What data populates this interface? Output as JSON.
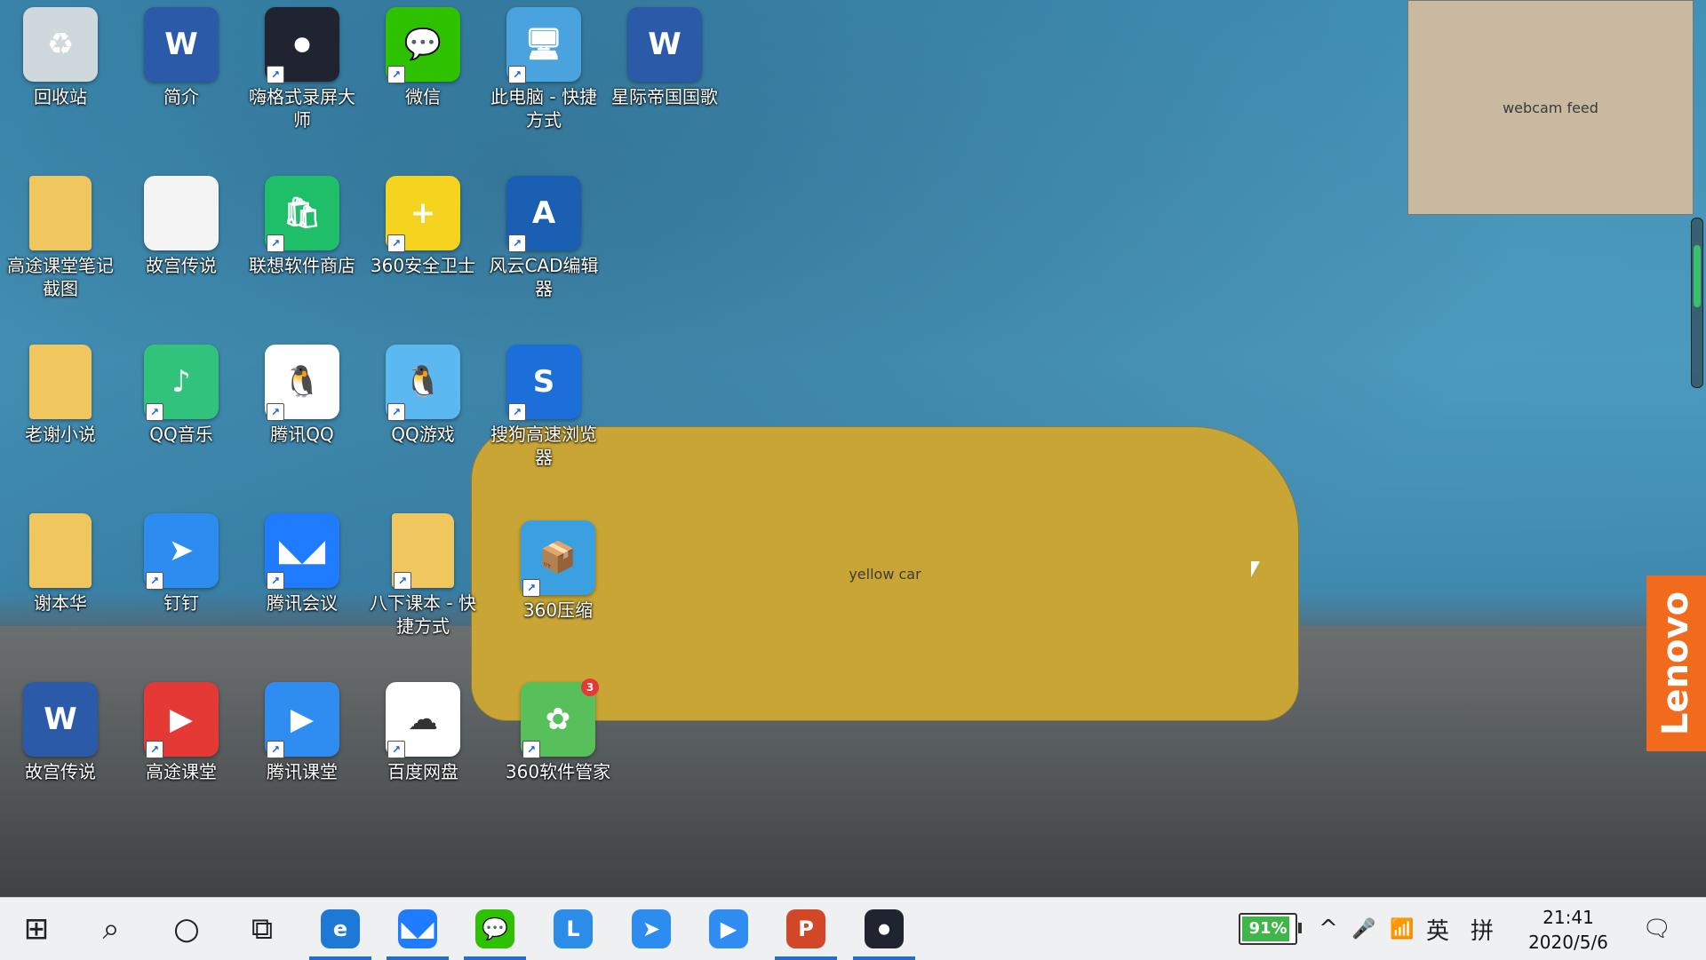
{
  "desktop_icons": [
    {
      "label": "回收站",
      "icon": "recycle-bin-icon",
      "glyph": "♻",
      "color": "#cfd8dc",
      "shortcut": false
    },
    {
      "label": "简介",
      "icon": "word-doc-icon",
      "glyph": "W",
      "color": "#2b5aa8",
      "shortcut": false
    },
    {
      "label": "嗨格式录屏大\n师",
      "icon": "screen-recorder-icon",
      "glyph": "⏺",
      "color": "#1f2430",
      "shortcut": true
    },
    {
      "label": "微信",
      "icon": "wechat-icon",
      "glyph": "💬",
      "color": "#2dc100",
      "shortcut": true
    },
    {
      "label": "此电脑 - 快捷\n方式",
      "icon": "this-pc-icon",
      "glyph": "🖥",
      "color": "#4aa3df",
      "shortcut": true
    },
    {
      "label": "星际帝国国歌",
      "icon": "word-doc-icon",
      "glyph": "W",
      "color": "#2b5aa8",
      "shortcut": false
    },
    {
      "label": "高途课堂笔记\n截图",
      "icon": "folder-icon",
      "glyph": "",
      "color": "#f0c75e",
      "shortcut": false
    },
    {
      "label": "故宫传说",
      "icon": "text-file-icon",
      "glyph": "",
      "color": "#f4f4f4",
      "shortcut": false
    },
    {
      "label": "联想软件商店",
      "icon": "lenovo-store-icon",
      "glyph": "🛍",
      "color": "#1fbf6a",
      "shortcut": true
    },
    {
      "label": "360安全卫士",
      "icon": "360-security-icon",
      "glyph": "+",
      "color": "#f4d41e",
      "shortcut": true
    },
    {
      "label": "风云CAD编辑\n器",
      "icon": "cad-editor-icon",
      "glyph": "A",
      "color": "#1b5fb3",
      "shortcut": true
    },
    {
      "label": "老谢小说",
      "icon": "folder-icon",
      "glyph": "",
      "color": "#f0c75e",
      "shortcut": false
    },
    {
      "label": "QQ音乐",
      "icon": "qq-music-icon",
      "glyph": "♪",
      "color": "#31c27c",
      "shortcut": true
    },
    {
      "label": "腾讯QQ",
      "icon": "qq-penguin-icon",
      "glyph": "🐧",
      "color": "#ffffff",
      "shortcut": true
    },
    {
      "label": "QQ游戏",
      "icon": "qq-game-icon",
      "glyph": "🐧",
      "color": "#5bb8f0",
      "shortcut": true
    },
    {
      "label": "搜狗高速浏览\n器",
      "icon": "sogou-browser-icon",
      "glyph": "S",
      "color": "#1c6fd8",
      "shortcut": true
    },
    {
      "label": "谢本华",
      "icon": "folder-icon",
      "glyph": "",
      "color": "#f0c75e",
      "shortcut": false
    },
    {
      "label": "钉钉",
      "icon": "dingtalk-icon",
      "glyph": "➤",
      "color": "#2d8cf0",
      "shortcut": true
    },
    {
      "label": "腾讯会议",
      "icon": "tencent-meeting-icon",
      "glyph": "◣◢",
      "color": "#1f7bff",
      "shortcut": true
    },
    {
      "label": "八下课本 - 快\n捷方式",
      "icon": "folder-icon",
      "glyph": "",
      "color": "#f0c75e",
      "shortcut": true
    },
    {
      "label": "360压缩",
      "icon": "360-zip-icon",
      "glyph": "📦",
      "color": "#3aa0e0",
      "shortcut": true
    },
    {
      "label": "故宫传说",
      "icon": "word-doc-icon",
      "glyph": "W",
      "color": "#2b5aa8",
      "shortcut": false
    },
    {
      "label": "高途课堂",
      "icon": "gaotu-classroom-icon",
      "glyph": "▶",
      "color": "#e53935",
      "shortcut": true
    },
    {
      "label": "腾讯课堂",
      "icon": "tencent-classroom-icon",
      "glyph": "▶",
      "color": "#2f8cf0",
      "shortcut": true
    },
    {
      "label": "百度网盘",
      "icon": "baidu-netdisk-icon",
      "glyph": "☁",
      "color": "#ffffff",
      "shortcut": true
    },
    {
      "label": "360软件管家",
      "icon": "360-software-manager-icon",
      "glyph": "✿",
      "color": "#58c05a",
      "shortcut": true,
      "badge": "3"
    }
  ],
  "webcam_overlay": {
    "icon": "webcam-feed"
  },
  "lenovo_tab": {
    "label": "Lenovo",
    "color": "#f26a1b"
  },
  "taskbar": {
    "start_icon": "windows-start-icon",
    "buttons": [
      {
        "name": "start-button",
        "icon": "windows-start-icon",
        "glyph": "⊞",
        "color": "",
        "active": false
      },
      {
        "name": "search-button",
        "icon": "search-icon",
        "glyph": "⌕",
        "color": "",
        "active": false
      },
      {
        "name": "cortana-button",
        "icon": "cortana-circle-icon",
        "glyph": "○",
        "color": "",
        "active": false
      },
      {
        "name": "task-view-button",
        "icon": "task-view-icon",
        "glyph": "⧉",
        "color": "",
        "active": false
      },
      {
        "name": "taskbar-edge",
        "icon": "edge-browser-icon",
        "glyph": "e",
        "color": "#1d78d6",
        "active": true
      },
      {
        "name": "taskbar-tencent-meeting",
        "icon": "tencent-meeting-icon",
        "glyph": "◣◢",
        "color": "#1f7bff",
        "active": true
      },
      {
        "name": "taskbar-wechat",
        "icon": "wechat-icon",
        "glyph": "💬",
        "color": "#2dc100",
        "active": true
      },
      {
        "name": "taskbar-lenovo-l",
        "icon": "lenovo-l-icon",
        "glyph": "L",
        "color": "#2b8de8",
        "active": false
      },
      {
        "name": "taskbar-dingtalk",
        "icon": "dingtalk-icon",
        "glyph": "➤",
        "color": "#2d8cf0",
        "active": false
      },
      {
        "name": "taskbar-tencent-classroom",
        "icon": "tencent-classroom-icon",
        "glyph": "▶",
        "color": "#2f8cf0",
        "active": false
      },
      {
        "name": "taskbar-powerpoint",
        "icon": "powerpoint-icon",
        "glyph": "P",
        "color": "#d24726",
        "active": true
      },
      {
        "name": "taskbar-screen-recorder",
        "icon": "screen-recorder-icon",
        "glyph": "⏺",
        "color": "#1f2430",
        "active": true
      }
    ],
    "battery_percent": "91%",
    "battery_level": 0.91,
    "tray": {
      "chevron_glyph": "^",
      "mic_glyph": "🎤",
      "wifi_glyph": "📶",
      "ime_lang": "英",
      "ime_mode": "拼",
      "notification_glyph": "🗨"
    },
    "time": "21:41",
    "date": "2020/5/6"
  }
}
